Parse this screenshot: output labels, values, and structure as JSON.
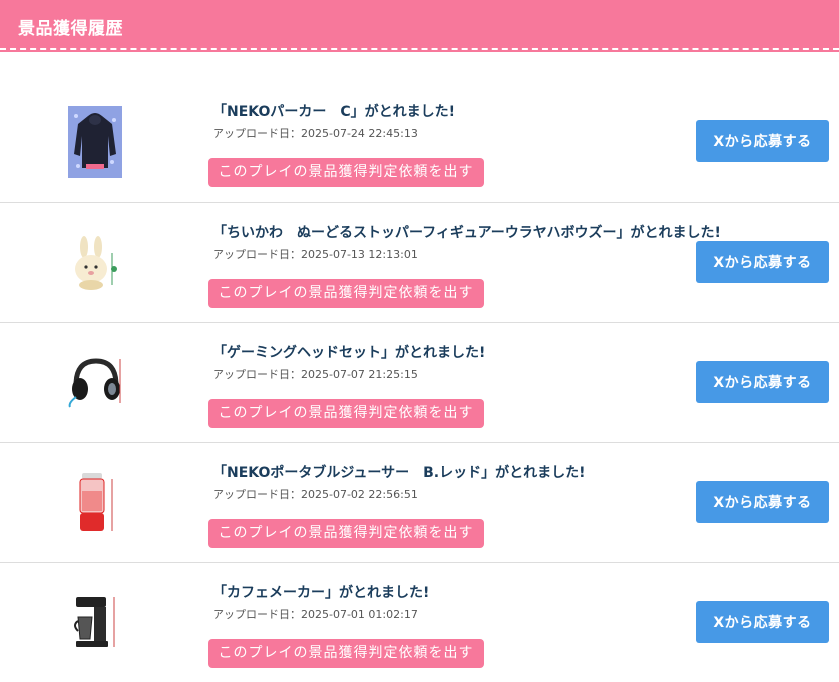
{
  "header": {
    "title": "景品獲得履歴"
  },
  "items": [
    {
      "title": "「NEKOパーカー　C」がとれました!",
      "upload": "アップロード日：2025-07-24 22:45:13",
      "judge_label": "このプレイの景品獲得判定依頼を出す",
      "x_label": "Xから応募する",
      "image_icon": "hoodie-image"
    },
    {
      "title": "「ちいかわ　ぬーどるストッパーフィギュアーウラヤハボウズー」がとれました!",
      "upload": "アップロード日：2025-07-13 12:13:01",
      "judge_label": "このプレイの景品獲得判定依頼を出す",
      "x_label": "Xから応募する",
      "image_icon": "figure-image"
    },
    {
      "title": "「ゲーミングヘッドセット」がとれました!",
      "upload": "アップロード日：2025-07-07 21:25:15",
      "judge_label": "このプレイの景品獲得判定依頼を出す",
      "x_label": "Xから応募する",
      "image_icon": "headset-image"
    },
    {
      "title": "「NEKOポータブルジューサー　B.レッド」がとれました!",
      "upload": "アップロード日：2025-07-02 22:56:51",
      "judge_label": "このプレイの景品獲得判定依頼を出す",
      "x_label": "Xから応募する",
      "image_icon": "juicer-image"
    },
    {
      "title": "「カフェメーカー」がとれました!",
      "upload": "アップロード日：2025-07-01 01:02:17",
      "judge_label": "このプレイの景品獲得判定依頼を出す",
      "x_label": "Xから応募する",
      "image_icon": "coffee-maker-image"
    }
  ],
  "colors": {
    "header": "#f7789b",
    "judge_button": "#f7789b",
    "x_button": "#4799e6",
    "title_text": "#1b3d5c"
  }
}
